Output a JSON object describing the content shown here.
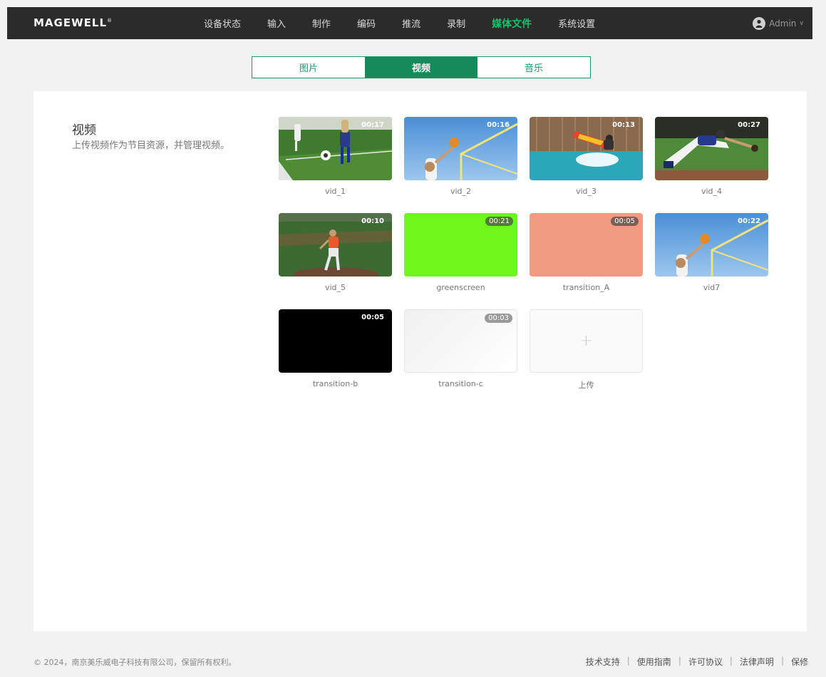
{
  "app": {
    "logo": "MAGEWELL",
    "logo_mark": "®"
  },
  "nav": {
    "items": [
      "设备状态",
      "输入",
      "制作",
      "编码",
      "推流",
      "录制",
      "媒体文件",
      "系统设置"
    ],
    "active_index": 6,
    "user": "Admin"
  },
  "tabs": [
    {
      "label": "图片",
      "active": false
    },
    {
      "label": "视频",
      "active": true
    },
    {
      "label": "音乐",
      "active": false
    }
  ],
  "section": {
    "title": "视频",
    "description": "上传视频作为节目资源，并管理视频。"
  },
  "videos": [
    {
      "name": "vid_1",
      "duration": "00:17",
      "thumb": "soccer"
    },
    {
      "name": "vid_2",
      "duration": "00:16",
      "thumb": "volleyball"
    },
    {
      "name": "vid_3",
      "duration": "00:13",
      "thumb": "surf"
    },
    {
      "name": "vid_4",
      "duration": "00:27",
      "thumb": "baseball-dive"
    },
    {
      "name": "vid_5",
      "duration": "00:10",
      "thumb": "pitcher"
    },
    {
      "name": "greenscreen",
      "duration": "00:21",
      "thumb": "solid-green"
    },
    {
      "name": "transition_A",
      "duration": "00:05",
      "thumb": "solid-salmon"
    },
    {
      "name": "vid7",
      "duration": "00:22",
      "thumb": "volleyball"
    },
    {
      "name": "transition-b",
      "duration": "00:05",
      "thumb": "solid-black"
    },
    {
      "name": "transition-c",
      "duration": "00:03",
      "thumb": "solid-white"
    }
  ],
  "upload": {
    "label": "上传",
    "icon": "plus-icon"
  },
  "colors": {
    "accent": "#168a59",
    "nav_active": "#16c16a",
    "green": "#6ef51a",
    "salmon": "#f29a80",
    "black": "#000000"
  },
  "footer": {
    "copyright": "© 2024，南京美乐威电子科技有限公司，保留所有权利。",
    "links": [
      "技术支持",
      "使用指南",
      "许可协议",
      "法律声明",
      "保修"
    ]
  }
}
